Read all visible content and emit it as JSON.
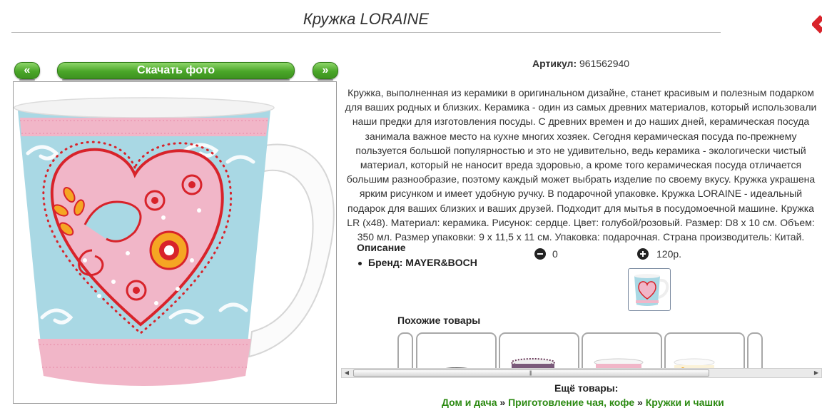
{
  "header": {
    "title": "Кружка LORAINE"
  },
  "gallery": {
    "prev_label": "«",
    "download_label": "Скачать фото",
    "next_label": "»"
  },
  "product": {
    "article_label": "Артикул:",
    "article_value": "961562940",
    "description": "Кружка, выполненная из керамики в оригинальном дизайне, станет красивым и полезным подарком для ваших родных и близких. Керамика - один из самых древних материалов, который использовали наши предки для изготовления посуды. С древних времен и до наших дней, керамическая посуда занимала важное место на кухне многих хозяек. Сегодня керамическая посуда по-прежнему пользуется большой популярностью и это не удивительно, ведь керамика - экологически чистый материал, который не наносит вреда здоровью, а кроме того керамическая посуда отличается большим разнообразие, поэтому каждый может выбрать изделие по своему вкусу. Кружка украшена ярким рисунком и имеет удобную ручку. В подарочной упаковке. Кружка LORAINE - идеальный подарок для ваших близких и ваших друзей. Подходит для мытья в посудомоечной машине. Кружка LR (х48). Материал: керамика. Рисунок: сердце. Цвет: голубой/розовый. Размер: D8 х 10 см. Объем: 350 мл. Размер упаковки: 9 х 11,5 х 11 см. Упаковка: подарочная. Страна производитель: Китай.",
    "section_title": "Описание",
    "brand_line": "Бренд: MAYER&BOCH",
    "quantity": "0",
    "price": "120р."
  },
  "similar": {
    "title": "Похожие товары"
  },
  "more": {
    "title": "Ещё товары:",
    "crumbs": [
      "Дом и дача",
      "Приготовление чая, кофе",
      "Кружки и чашки"
    ],
    "separator": "»"
  },
  "colors": {
    "button_green": "#4aa628",
    "link_green": "#2c8a12",
    "mug_blue": "#a9d8e4",
    "heart_pink": "#f1b6c8",
    "heart_red": "#d8232a",
    "close_red": "#d8232a"
  }
}
